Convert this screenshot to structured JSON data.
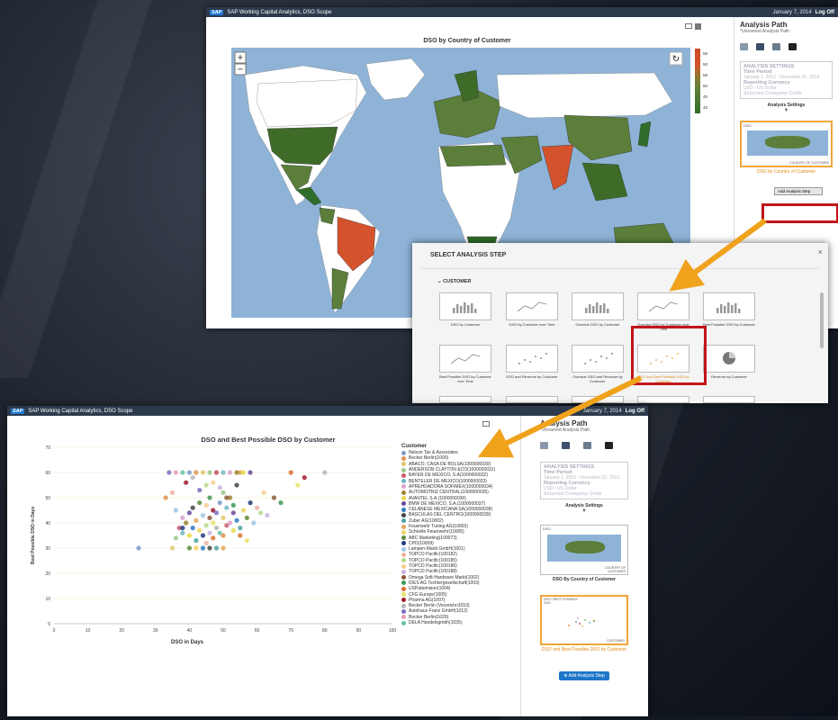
{
  "app": {
    "title": "SAP Working Capital Analytics, DSO Scope",
    "sap_logo": "SAP",
    "date": "January 7, 2014",
    "logoff": "Log Off"
  },
  "map_window": {
    "chart_title": "DSO by Country of Customer",
    "zoom_in": "+",
    "zoom_out": "−",
    "legend_ticks": [
      "55",
      "50",
      "55",
      "50",
      "45",
      "40"
    ],
    "colors": {
      "ocean": "#8eb3d6",
      "land_white": "#ffffff",
      "high": "#d4532d",
      "mid": "#5b7f3a",
      "low": "#2f6e2a",
      "neutral": "#d8d0b8"
    }
  },
  "analysis_path_top": {
    "title": "Analysis Path",
    "subtitle": "*Unnamed Analysis Path",
    "settings_heading": "ANALYSIS SETTINGS",
    "time_period_label": "Time Period",
    "time_period_value": "January 1, 2013 - December 31, 2013",
    "currency_label": "Reporting Currency",
    "currency_value": "USD - US Dollar",
    "company_label": "Selected Company Code",
    "settings_button": "Analysis Settings",
    "step_card_tag": "DSO",
    "step_card_caption": "COUNTRY OF CUSTOMER",
    "step_label": "DSO by Country of Customer",
    "add_step": "Add Analysis Step"
  },
  "select_dialog": {
    "title": "SELECT ANALYSIS STEP",
    "close": "×",
    "section": "CUSTOMER",
    "tiles": [
      {
        "label": "DSO by Customer",
        "kind": "bar"
      },
      {
        "label": "DSO by Customer over Time",
        "kind": "line"
      },
      {
        "label": "Overdue DSO by Customer",
        "kind": "bar"
      },
      {
        "label": "Overdue DSO by Customer over Time",
        "kind": "line"
      },
      {
        "label": "Best Possible DSO by Customer",
        "kind": "bar"
      },
      {
        "label": "Best Possible DSO by Customer over Time",
        "kind": "line"
      },
      {
        "label": "DSO and Revenue by Customer",
        "kind": "scatter"
      },
      {
        "label": "Overdue DSO and Revenue by Customer",
        "kind": "scatter"
      },
      {
        "label": "DSO and Best Possible DSO by Customer",
        "kind": "scatter-orange"
      },
      {
        "label": "Revenue by Customer",
        "kind": "pie"
      }
    ]
  },
  "scatter_window": {
    "chart_title": "DSO and Best Possible DSO by Customer",
    "legend_title": "Customer",
    "legend_items": [
      {
        "name": "Nelson Tax & Associates",
        "color": "#7a9bc9"
      },
      {
        "name": "Becker Berlin(1000)",
        "color": "#e2914b"
      },
      {
        "name": "ABACO, CASA DE BOLSA(1000000030)",
        "color": "#e0c96c"
      },
      {
        "name": "ANDERSON CLAYTON &CO(1000000031)",
        "color": "#9fc58c"
      },
      {
        "name": "BAYER DE MEXICO, S.A(1000000032)",
        "color": "#c75a6a"
      },
      {
        "name": "BENTELER DE MEXICO(1000000033)",
        "color": "#6fb6c4"
      },
      {
        "name": "APREHDADORA SOFIMEX(1000000034)",
        "color": "#d8a2c9"
      },
      {
        "name": "AUTOMOTRIZ CENTRAL(1000000035)",
        "color": "#a0822f"
      },
      {
        "name": "AVANTEL S.A.(1000000036)",
        "color": "#e9d94a"
      },
      {
        "name": "BMW DE MEXICO, S.A.(1000000037)",
        "color": "#6a4a9c"
      },
      {
        "name": "CELANESE MEXICANA SA(1000000038)",
        "color": "#2f7bc4"
      },
      {
        "name": "BASCULAS DEL CENTRO(1000000039)",
        "color": "#444444"
      },
      {
        "name": "Zuber AG(10002)",
        "color": "#4aa3a0"
      },
      {
        "name": "Feuerwehr Tuning AG(10003)",
        "color": "#e4a85b"
      },
      {
        "name": "Schnelle Feuerwehr(10005)",
        "color": "#f0d45c"
      },
      {
        "name": "ABC Marketing(100073)",
        "color": "#5d8c3a"
      },
      {
        "name": "CPD(10009)",
        "color": "#213b7a"
      },
      {
        "name": "Lampen-Markt GmbH(1001)",
        "color": "#9bc7e8"
      },
      {
        "name": "TOPCO Pacific(100182)",
        "color": "#f2b3a0"
      },
      {
        "name": "TOPCO Pacific(100185)",
        "color": "#b7d88c"
      },
      {
        "name": "TOPCO Pacific(100186)",
        "color": "#f4cf8a"
      },
      {
        "name": "TOPCO Pacific(100188)",
        "color": "#c9b3df"
      },
      {
        "name": "Omega Soft-Hardware Markt(1002)",
        "color": "#8e5a3a"
      },
      {
        "name": "IDES AG Tochtergesellschaft(1003)",
        "color": "#3e9a55"
      },
      {
        "name": "USPattemsion(1004)",
        "color": "#d96f2e"
      },
      {
        "name": "CFG Europe(1005)",
        "color": "#e6e06a"
      },
      {
        "name": "Pharma AG(1007)",
        "color": "#a21b2c"
      },
      {
        "name": "Becker Berlin (Verzeichn1010)",
        "color": "#b6b6b6"
      },
      {
        "name": "Autohaus Franz GmbH(1012)",
        "color": "#7a6fbf"
      },
      {
        "name": "Becker Berlin(1020)",
        "color": "#e59fb1"
      },
      {
        "name": "DELA Handelsgmbh(1035)",
        "color": "#66c2a5"
      }
    ],
    "x_axis_label": "DSO in Days",
    "y_axis_label": "Best Possible DSO in Days",
    "x_ticks": [
      "0",
      "10",
      "20",
      "30",
      "40",
      "50",
      "60",
      "70",
      "80",
      "90",
      "100"
    ],
    "y_ticks": [
      "0",
      "10",
      "20",
      "30",
      "40",
      "50",
      "60",
      "70"
    ]
  },
  "analysis_path_bottom": {
    "title": "Analysis Path",
    "subtitle": "*Unnamed Analysis Path",
    "settings_heading": "ANALYSIS SETTINGS",
    "time_period_label": "Time Period",
    "time_period_value": "January 1, 2013 - December 31, 2013",
    "currency_label": "Reporting Currency",
    "currency_value": "USD - US Dollar",
    "company_label": "Selected Company Code",
    "settings_button": "Analysis Settings",
    "step1_tag": "DSO",
    "step1_caption": "COUNTRY OF CUSTOMER",
    "step1_label": "DSO By Country of Customer",
    "step2_tag": "DSO / BEST POSSIBLE DSO",
    "step2_caption": "CUSTOMER",
    "step2_label": "DSO and Best Possible DSO by Customer",
    "add_step": "Add Analysis Step"
  },
  "chart_data": {
    "type": "scatter",
    "title": "DSO and Best Possible DSO by Customer",
    "xlabel": "DSO in Days",
    "ylabel": "Best Possible DSO in Days",
    "xlim": [
      0,
      100
    ],
    "ylim": [
      0,
      70
    ],
    "x": [
      25,
      33,
      35,
      36,
      37,
      38,
      38,
      39,
      40,
      40,
      41,
      41,
      42,
      42,
      43,
      43,
      44,
      44,
      45,
      45,
      45,
      46,
      46,
      46,
      47,
      47,
      47,
      48,
      48,
      48,
      49,
      49,
      50,
      50,
      50,
      51,
      51,
      52,
      52,
      53,
      53,
      54,
      54,
      55,
      55,
      56,
      57,
      58,
      59,
      60,
      61,
      62,
      63,
      65,
      67,
      70,
      72,
      74,
      80,
      34,
      36,
      38,
      40,
      42,
      44,
      46,
      48,
      50,
      52,
      54,
      56,
      58,
      44,
      46,
      48,
      50,
      42,
      40,
      38,
      36,
      35,
      45,
      47,
      49,
      51,
      53,
      55,
      57,
      39,
      41,
      43
    ],
    "y": [
      30,
      50,
      30,
      34,
      38,
      36,
      42,
      40,
      35,
      44,
      38,
      46,
      33,
      41,
      37,
      48,
      35,
      43,
      32,
      39,
      47,
      36,
      42,
      50,
      34,
      40,
      45,
      38,
      44,
      60,
      36,
      48,
      35,
      42,
      52,
      39,
      46,
      40,
      50,
      37,
      44,
      41,
      55,
      38,
      60,
      45,
      42,
      48,
      40,
      46,
      44,
      52,
      43,
      50,
      48,
      60,
      55,
      58,
      60,
      60,
      60,
      60,
      60,
      60,
      60,
      60,
      60,
      60,
      60,
      60,
      60,
      60,
      30,
      30,
      30,
      30,
      30,
      30,
      38,
      45,
      52,
      55,
      56,
      54,
      50,
      47,
      35,
      33,
      56,
      58,
      53
    ]
  }
}
